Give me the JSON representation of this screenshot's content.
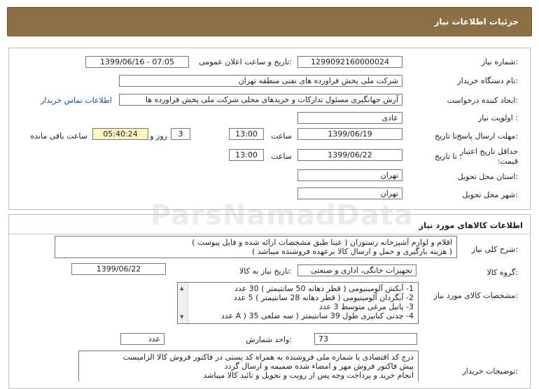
{
  "header": {
    "title": "جزئیات اطلاعات نیاز"
  },
  "info": {
    "need_number_label": "شماره نیاز:",
    "need_number": "1299092160000024",
    "announce_label": "تاریخ و ساعت اعلان عمومی:",
    "announce_value": "1399/06/16 - 07:05",
    "buyer_label": "نام دستگاه خریدار:",
    "buyer_value": "شرکت ملی پخش فراورده های نفتی منطقه تهران",
    "creator_label": "ایجاد کننده درخواست:",
    "creator_value": "آرش جهانگیری مسئول تدارکات و خریدهای محلی  شرکت ملی پخش فراورده ها",
    "contact_link": "اطلاعات تماس خریدار",
    "priority_label": "اولویت نیاز :",
    "priority_value": "عادی",
    "deadline_label": "مهلت ارسال پاسخ:",
    "to_date_label": "تا تاریخ :",
    "deadline_date": "1399/06/19",
    "time_label": "ساعت",
    "deadline_time": "13:00",
    "days_value": "3",
    "days_label": "روز و",
    "remaining_time": "05:40:24",
    "remaining_label": "ساعت باقی مانده",
    "validity_label": "حداقل تاریخ اعتبار قیمت:",
    "validity_date": "1399/06/22",
    "validity_time": "13:00",
    "province_label": "استان محل تحویل:",
    "province_value": "تهران",
    "city_label": "شهر محل تحویل:",
    "city_value": "تهران"
  },
  "goods": {
    "title": "اطلاعات کالاهای مورد نیاز",
    "summary_label": "شرح کلی نیاز:",
    "summary_lines": [
      "اقلام و لوازم آشپزخانه رستوران ( عینا طبق مشخصات ارائه شده و فایل پیوست )",
      "( هزینه بارگیری و حمل و ارسال کالا برعهده فروشنده میباشد )"
    ],
    "group_label": "گروه کالا:",
    "group_value": "تجهیزات خانگی، اداری و صنعتی",
    "need_date_label": "تاریخ نیاز به کالا:",
    "need_date_value": "1399/06/22",
    "specs_label": "مشخصات کالای مورد نیاز:",
    "specs_lines": [
      "1- آبکش آلومینیومی ( قطر دهانه 50 سانتیمتر ) 30 عدد",
      "2- آبگردان آلومینیومی ( قطر دهانه 28 سانتیمتر ) 5 عدد",
      "3- پاتیل مرغی متوسط    3 عدد",
      "4- چدنی کبابپزی طول 39 سانتیمتر ( سه ضلعی 35    ( A عدد"
    ],
    "count_value": "73",
    "unit_label": "واحد شمارش:",
    "unit_value": "عدد",
    "buyer_notes_label": "توضیحات خریدار:",
    "buyer_notes_lines": [
      "درج کد اقتصادی یا شماره ملی فروشنده به همراه کد پستی در فاکتور فروش کالا الزامیست",
      "پیش فاکتور فروش مهر و امضاء شده ضمیمه و ارسال گردد",
      "انجام خرید و پرداخت وجه پس از رویت و تحویل و تائید کالا میباشد"
    ]
  },
  "watermark": "ParsNamadData"
}
